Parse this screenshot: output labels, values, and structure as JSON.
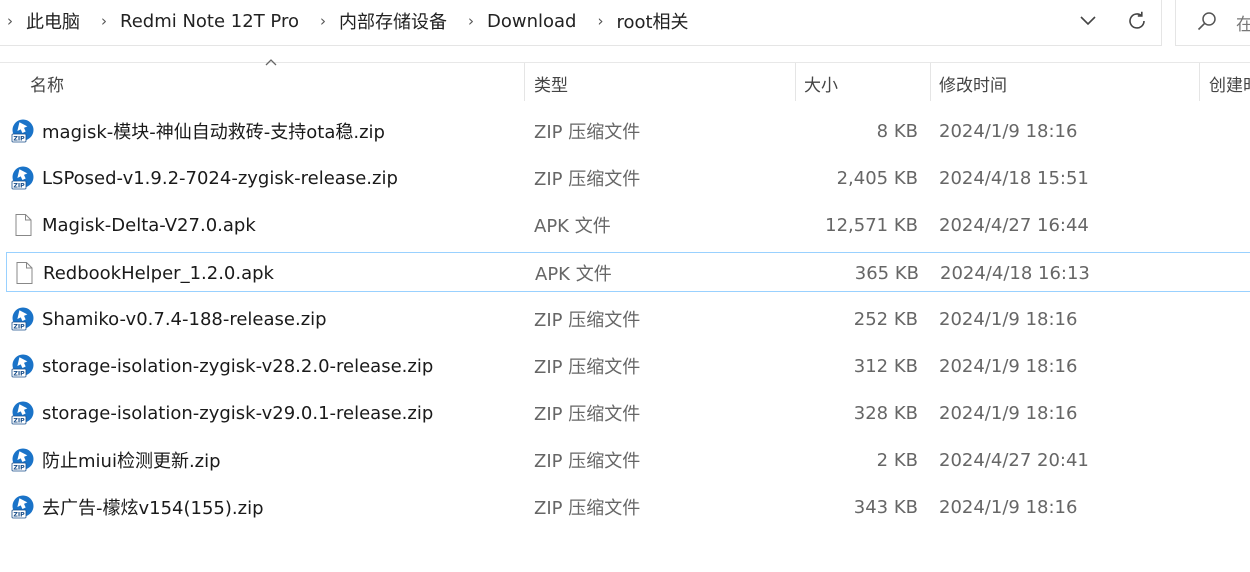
{
  "breadcrumb": {
    "items": [
      "此电脑",
      "Redmi Note 12T Pro",
      "内部存储设备",
      "Download",
      "root相关"
    ]
  },
  "search": {
    "placeholder": "在"
  },
  "columns": {
    "name": "名称",
    "type": "类型",
    "size": "大小",
    "modified": "修改时间",
    "created": "创建时"
  },
  "files": [
    {
      "name": " magisk-模块-神仙自动救砖-支持ota稳.zip",
      "type": "ZIP 压缩文件",
      "size": "8 KB",
      "modified": "2024/1/9 18:16",
      "icon": "zip-file-icon"
    },
    {
      "name": "LSPosed-v1.9.2-7024-zygisk-release.zip",
      "type": "ZIP 压缩文件",
      "size": "2,405 KB",
      "modified": "2024/4/18 15:51",
      "icon": "zip-file-icon"
    },
    {
      "name": "Magisk-Delta-V27.0.apk",
      "type": "APK 文件",
      "size": "12,571 KB",
      "modified": "2024/4/27 16:44",
      "icon": "blank-file-icon"
    },
    {
      "name": "RedbookHelper_1.2.0.apk",
      "type": "APK 文件",
      "size": "365 KB",
      "modified": "2024/4/18 16:13",
      "icon": "blank-file-icon"
    },
    {
      "name": "Shamiko-v0.7.4-188-release.zip",
      "type": "ZIP 压缩文件",
      "size": "252 KB",
      "modified": "2024/1/9 18:16",
      "icon": "zip-file-icon"
    },
    {
      "name": "storage-isolation-zygisk-v28.2.0-release.zip",
      "type": "ZIP 压缩文件",
      "size": "312 KB",
      "modified": "2024/1/9 18:16",
      "icon": "zip-file-icon"
    },
    {
      "name": "storage-isolation-zygisk-v29.0.1-release.zip",
      "type": "ZIP 压缩文件",
      "size": "328 KB",
      "modified": "2024/1/9 18:16",
      "icon": "zip-file-icon"
    },
    {
      "name": "防止miui检测更新.zip",
      "type": "ZIP 压缩文件",
      "size": "2 KB",
      "modified": "2024/4/27 20:41",
      "icon": "zip-file-icon"
    },
    {
      "name": "去广告-檬炫v154(155).zip",
      "type": "ZIP 压缩文件",
      "size": "343 KB",
      "modified": "2024/1/9 18:16",
      "icon": "zip-file-icon"
    }
  ],
  "colors": {
    "zip_icon_blue": "#1a73c8",
    "focus_border": "#99d1ff"
  }
}
